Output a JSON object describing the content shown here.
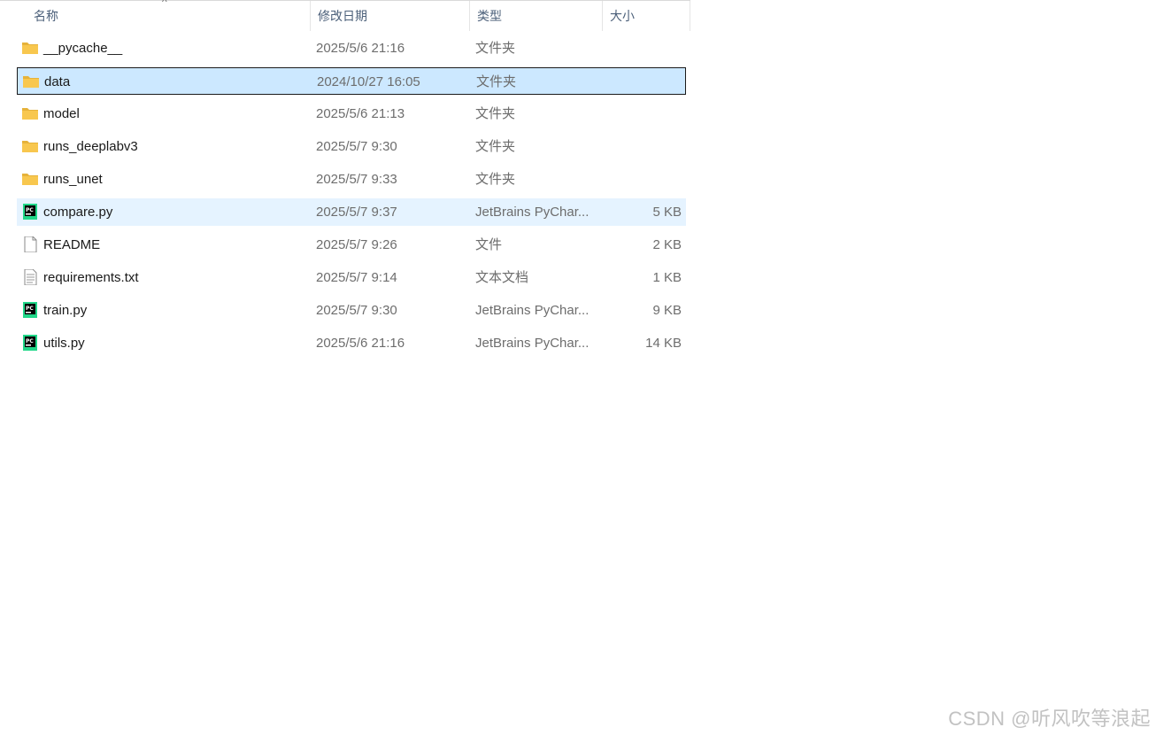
{
  "columns": {
    "name": "名称",
    "date": "修改日期",
    "type": "类型",
    "size": "大小"
  },
  "sort_indicator": "^",
  "files": [
    {
      "name": "__pycache__",
      "date": "2025/5/6 21:16",
      "type": "文件夹",
      "size": "",
      "icon": "folder-icon"
    },
    {
      "name": "data",
      "date": "2024/10/27 16:05",
      "type": "文件夹",
      "size": "",
      "icon": "folder-icon",
      "state": "selected"
    },
    {
      "name": "model",
      "date": "2025/5/6 21:13",
      "type": "文件夹",
      "size": "",
      "icon": "folder-icon"
    },
    {
      "name": "runs_deeplabv3",
      "date": "2025/5/7 9:30",
      "type": "文件夹",
      "size": "",
      "icon": "folder-icon"
    },
    {
      "name": "runs_unet",
      "date": "2025/5/7 9:33",
      "type": "文件夹",
      "size": "",
      "icon": "folder-icon"
    },
    {
      "name": "compare.py",
      "date": "2025/5/7 9:37",
      "type": "JetBrains PyChar...",
      "size": "5 KB",
      "icon": "pycharm-file-icon",
      "state": "hover"
    },
    {
      "name": "README",
      "date": "2025/5/7 9:26",
      "type": "文件",
      "size": "2 KB",
      "icon": "blank-file-icon"
    },
    {
      "name": "requirements.txt",
      "date": "2025/5/7 9:14",
      "type": "文本文档",
      "size": "1 KB",
      "icon": "text-file-icon"
    },
    {
      "name": "train.py",
      "date": "2025/5/7 9:30",
      "type": "JetBrains PyChar...",
      "size": "9 KB",
      "icon": "pycharm-file-icon"
    },
    {
      "name": "utils.py",
      "date": "2025/5/6 21:16",
      "type": "JetBrains PyChar...",
      "size": "14 KB",
      "icon": "pycharm-file-icon"
    }
  ],
  "watermark": "CSDN @听风吹等浪起",
  "colors": {
    "selected_bg": "#cce8ff",
    "hover_bg": "#e5f3ff",
    "folder": "#f8c74e",
    "header_text": "#4c607a"
  }
}
